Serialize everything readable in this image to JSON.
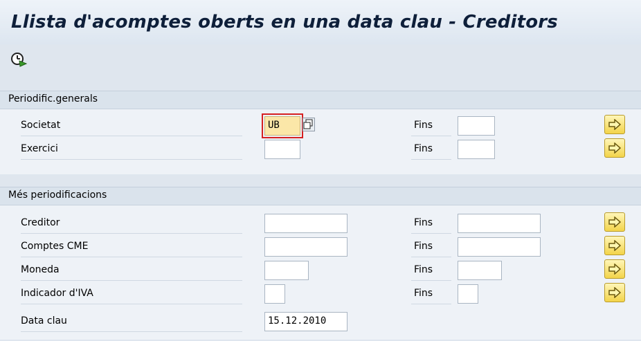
{
  "window": {
    "title": "Llista d'acomptes oberts en una data clau - Creditors"
  },
  "toolbar": {
    "execute_icon": "execute-clock-icon"
  },
  "groups": {
    "general": {
      "title": "Periodific.generals",
      "rows": {
        "societat": {
          "label": "Societat",
          "value": "UB",
          "fins_label": "Fins",
          "to_value": ""
        },
        "exercici": {
          "label": "Exercici",
          "value": "",
          "fins_label": "Fins",
          "to_value": ""
        }
      }
    },
    "more": {
      "title": "Més periodificacions",
      "rows": {
        "creditor": {
          "label": "Creditor",
          "value": "",
          "fins_label": "Fins",
          "to_value": ""
        },
        "comptes": {
          "label": "Comptes CME",
          "value": "",
          "fins_label": "Fins",
          "to_value": ""
        },
        "moneda": {
          "label": "Moneda",
          "value": "",
          "fins_label": "Fins",
          "to_value": ""
        },
        "iva": {
          "label": "Indicador d'IVA",
          "value": "",
          "fins_label": "Fins",
          "to_value": ""
        },
        "data_clau": {
          "label": "Data clau",
          "value": "15.12.2010"
        }
      }
    }
  },
  "colors": {
    "required_field": "#fbe7a8",
    "focus_border": "#d62020",
    "multi_select_button": "#f3d44a"
  },
  "icons": {
    "multiple_selection": "arrow-right-icon",
    "matchcode": "copy-window-icon"
  }
}
